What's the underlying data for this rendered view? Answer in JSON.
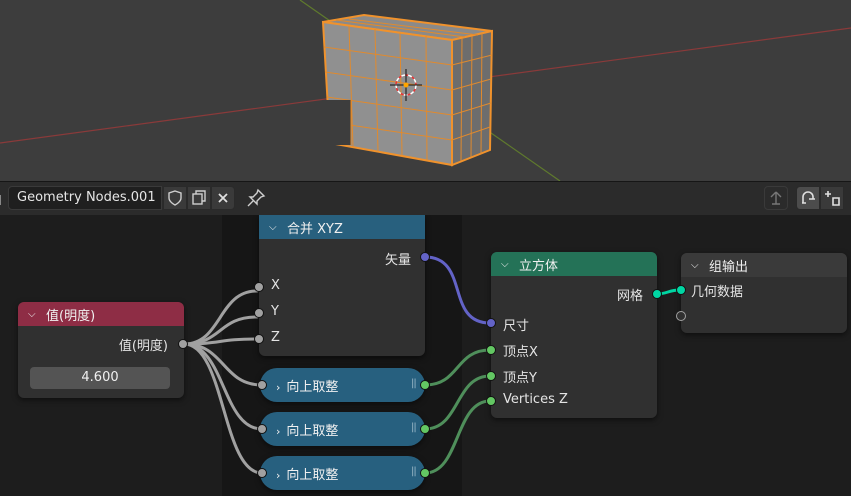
{
  "header": {
    "tree_name": "Geometry Nodes.001",
    "icons": [
      "shield-icon",
      "duplicate-icon",
      "close-icon",
      "pin-icon",
      "parent-up-icon",
      "snap-icon",
      "overlay-icon"
    ]
  },
  "nodes": {
    "value": {
      "title": "值(明度)",
      "output_label": "值(明度)",
      "value": "4.600",
      "color": "#8e2d45"
    },
    "combine": {
      "title": "合并 XYZ",
      "output_label": "矢量",
      "inputs": [
        "X",
        "Y",
        "Z"
      ],
      "color": "#28607e"
    },
    "ceil": [
      {
        "title": "向上取整"
      },
      {
        "title": "向上取整"
      },
      {
        "title": "向上取整"
      }
    ],
    "cube": {
      "title": "立方体",
      "output_label": "网格",
      "inputs": [
        "尺寸",
        "顶点X",
        "顶点Y",
        "Vertices Z"
      ],
      "color": "#247257"
    },
    "group_output": {
      "title": "组输出",
      "input_label": "几何数据",
      "color": "#3a3a3a"
    }
  },
  "colors": {
    "vector_socket": "#6363c7",
    "int_socket": "#63c763",
    "geometry_socket": "#00d6a3",
    "float_socket": "#a1a1a1",
    "selection": "#ff9a2e"
  }
}
